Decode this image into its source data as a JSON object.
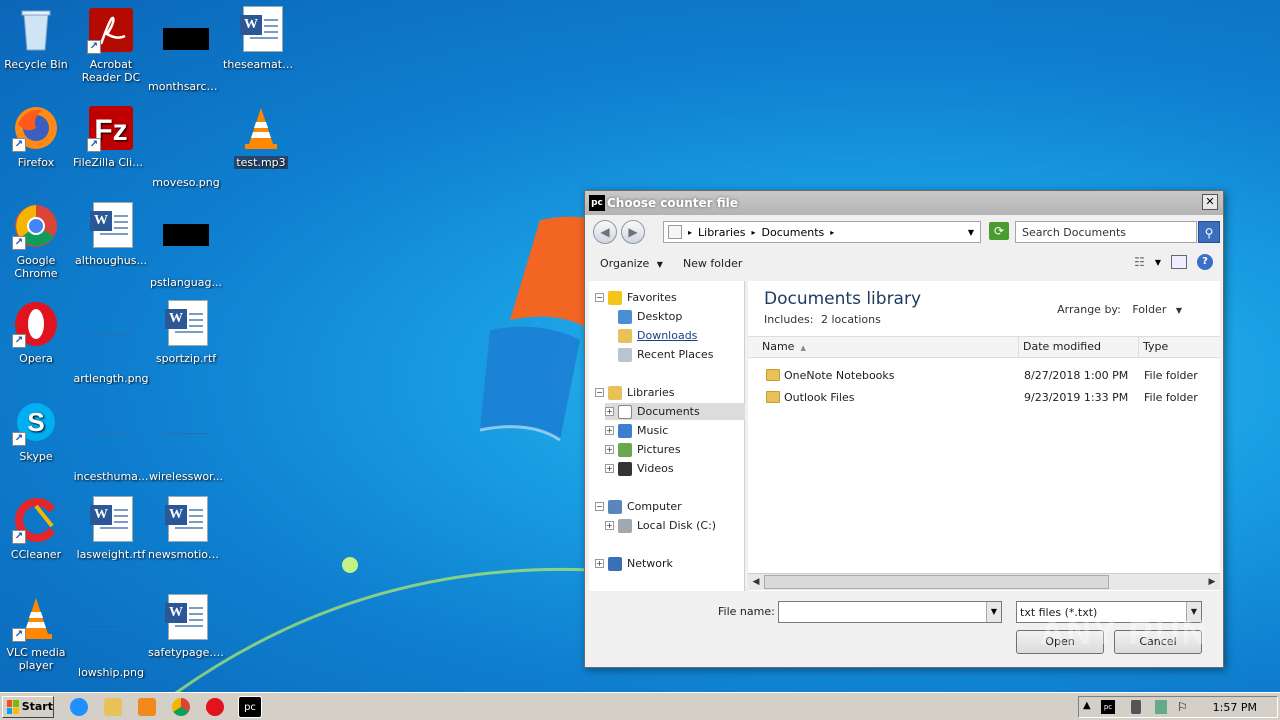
{
  "desktop": {
    "icons": [
      {
        "label": "Recycle Bin"
      },
      {
        "label": "Acrobat Reader DC"
      },
      {
        "label": "monthsarchi..."
      },
      {
        "label": "theseamate..."
      },
      {
        "label": "Firefox"
      },
      {
        "label": "FileZilla Client"
      },
      {
        "label": "moveso.png"
      },
      {
        "label": "test.mp3"
      },
      {
        "label": "Google Chrome"
      },
      {
        "label": "althoughus..."
      },
      {
        "label": "pstlanguag..."
      },
      {
        "label": "Opera"
      },
      {
        "label": "artlength.png"
      },
      {
        "label": "sportzip.rtf"
      },
      {
        "label": "Skype"
      },
      {
        "label": "incesthuma..."
      },
      {
        "label": "wirelesswor..."
      },
      {
        "label": "CCleaner"
      },
      {
        "label": "lasweight.rtf"
      },
      {
        "label": "newsmotion..."
      },
      {
        "label": "VLC media player"
      },
      {
        "label": "lowship.png"
      },
      {
        "label": "safetypage.rtf"
      }
    ]
  },
  "dialog": {
    "title": "Choose counter file",
    "close": "✕",
    "address": {
      "seg1": "Libraries",
      "seg2": "Documents"
    },
    "search_placeholder": "Search Documents",
    "toolbar": {
      "organize": "Organize",
      "new_folder": "New folder"
    },
    "nav": {
      "favorites": "Favorites",
      "desktop": "Desktop",
      "downloads": "Downloads",
      "recent": "Recent Places",
      "libraries": "Libraries",
      "documents": "Documents",
      "music": "Music",
      "pictures": "Pictures",
      "videos": "Videos",
      "computer": "Computer",
      "localdisk": "Local Disk (C:)",
      "network": "Network"
    },
    "library": {
      "title": "Documents library",
      "includes_label": "Includes:",
      "includes_link": "2 locations",
      "arrange_label": "Arrange by:",
      "arrange_value": "Folder"
    },
    "columns": {
      "name": "Name",
      "date": "Date modified",
      "type": "Type"
    },
    "files": [
      {
        "name": "OneNote Notebooks",
        "date": "8/27/2018 1:00 PM",
        "type": "File folder"
      },
      {
        "name": "Outlook Files",
        "date": "9/23/2019 1:33 PM",
        "type": "File folder"
      }
    ],
    "file_name_label": "File name:",
    "file_name_value": "",
    "file_type": "txt files (*.txt)",
    "open_label": "Open",
    "cancel_label": "Cancel"
  },
  "watermark": "ANY RUN",
  "taskbar": {
    "start": "Start",
    "clock": "1:57 PM"
  }
}
